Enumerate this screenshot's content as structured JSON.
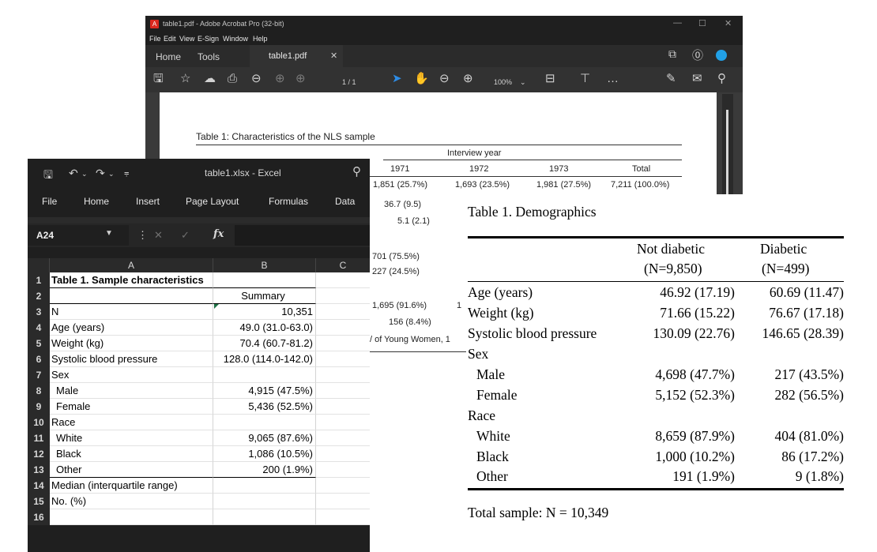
{
  "acrobat": {
    "title": "table1.pdf - Adobe Acrobat Pro (32-bit)",
    "menu": [
      "File",
      "Edit",
      "View",
      "E-Sign",
      "Window",
      "Help"
    ],
    "tabs": [
      "Home",
      "Tools"
    ],
    "file_tab": "table1.pdf",
    "page_indicator": "1 / 1",
    "zoom": "100%",
    "pdf": {
      "caption": "Table 1: Characteristics of the NLS sample",
      "spanner": "Interview year",
      "columns": [
        "1971",
        "1972",
        "1973",
        "Total"
      ],
      "row_n": [
        "1,851 (25.7%)",
        "1,693 (23.5%)",
        "1,981 (27.5%)",
        "7,211 (100.0%)"
      ],
      "partial_vals": [
        "36.7 (9.5)",
        "5.1 (2.1)",
        "701 (75.5%)",
        "227 (24.5%)",
        "1,695 (91.6%)",
        "1",
        "156 (8.4%)",
        "/ of Young Women, 1"
      ]
    }
  },
  "excel": {
    "qat_icons": [
      "save-icon",
      "undo-icon",
      "redo-icon",
      "customize-icon"
    ],
    "filename": "table1.xlsx - Excel",
    "ribbon": [
      "File",
      "Home",
      "Insert",
      "Page Layout",
      "Formulas",
      "Data"
    ],
    "namebox": "A24",
    "fx": "fx",
    "columns": [
      "A",
      "B",
      "C"
    ],
    "rows": [
      {
        "n": "1",
        "a": "Table 1. Sample characteristics",
        "b": ""
      },
      {
        "n": "2",
        "a": "",
        "b": "Summary"
      },
      {
        "n": "3",
        "a": "N",
        "b": "10,351"
      },
      {
        "n": "4",
        "a": "Age (years)",
        "b": "49.0 (31.0-63.0)"
      },
      {
        "n": "5",
        "a": "Weight (kg)",
        "b": "70.4 (60.7-81.2)"
      },
      {
        "n": "6",
        "a": "Systolic blood pressure",
        "b": "128.0 (114.0-142.0)"
      },
      {
        "n": "7",
        "a": "Sex",
        "b": ""
      },
      {
        "n": "8",
        "a": "Male",
        "b": "4,915 (47.5%)"
      },
      {
        "n": "9",
        "a": "Female",
        "b": "5,436 (52.5%)"
      },
      {
        "n": "10",
        "a": "Race",
        "b": ""
      },
      {
        "n": "11",
        "a": "White",
        "b": "9,065 (87.6%)"
      },
      {
        "n": "12",
        "a": "Black",
        "b": "1,086 (10.5%)"
      },
      {
        "n": "13",
        "a": "Other",
        "b": "200 (1.9%)"
      },
      {
        "n": "14",
        "a": "Median (interquartile range)",
        "b": ""
      },
      {
        "n": "15",
        "a": "No. (%)",
        "b": ""
      },
      {
        "n": "16",
        "a": "",
        "b": ""
      }
    ]
  },
  "demographics": {
    "title": "Table 1. Demographics",
    "col1": [
      "Not diabetic",
      "(N=9,850)"
    ],
    "col2": [
      "Diabetic",
      "(N=499)"
    ],
    "rows": [
      {
        "label": "Age (years)",
        "v1": "46.92 (17.19)",
        "v2": "60.69 (11.47)"
      },
      {
        "label": "Weight (kg)",
        "v1": "71.66 (15.22)",
        "v2": "76.67 (17.18)"
      },
      {
        "label": "Systolic blood pressure",
        "v1": "130.09 (22.76)",
        "v2": "146.65 (28.39)"
      },
      {
        "label": "Sex",
        "v1": "",
        "v2": ""
      },
      {
        "label": "Male",
        "v1": "4,698 (47.7%)",
        "v2": "217 (43.5%)"
      },
      {
        "label": "Female",
        "v1": "5,152 (52.3%)",
        "v2": "282 (56.5%)"
      },
      {
        "label": "Race",
        "v1": "",
        "v2": ""
      },
      {
        "label": "White",
        "v1": "8,659 (87.9%)",
        "v2": "404 (81.0%)"
      },
      {
        "label": "Black",
        "v1": "1,000 (10.2%)",
        "v2": "86 (17.2%)"
      },
      {
        "label": "Other",
        "v1": "191 (1.9%)",
        "v2": "9 (1.8%)"
      }
    ],
    "footnote": "Total sample: N = 10,349"
  }
}
